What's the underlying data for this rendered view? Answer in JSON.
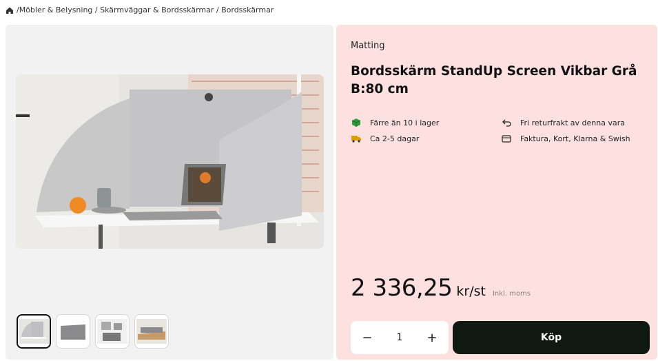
{
  "breadcrumb": {
    "icon": "home-icon",
    "path": "/Möbler & Belysning / Skärmväggar & Bordsskärmar / Bordsskärmar"
  },
  "product": {
    "brand": "Matting",
    "title": "Bordsskärm StandUp Screen Vikbar Grå B:80 cm"
  },
  "features": [
    {
      "icon": "stock-cube-icon",
      "text": "Färre än 10 i lager",
      "color": "#2e9b3a"
    },
    {
      "icon": "return-arrow-icon",
      "text": "Fri returfrakt av denna vara"
    },
    {
      "icon": "delivery-truck-icon",
      "text": "Ca 2-5 dagar",
      "color": "#d9a000"
    },
    {
      "icon": "card-icon",
      "text": "Faktura, Kort, Klarna & Swish"
    }
  ],
  "price": {
    "amount": "2 336,25",
    "unit": "kr/st",
    "vat_note": "Inkl. moms"
  },
  "quantity": {
    "minus": "−",
    "value": "1",
    "plus": "+"
  },
  "buy_button": {
    "label": "Köp"
  },
  "colors": {
    "info_bg": "#fde1e1",
    "gallery_bg": "#f2f2f2",
    "buy_bg": "#101812"
  }
}
